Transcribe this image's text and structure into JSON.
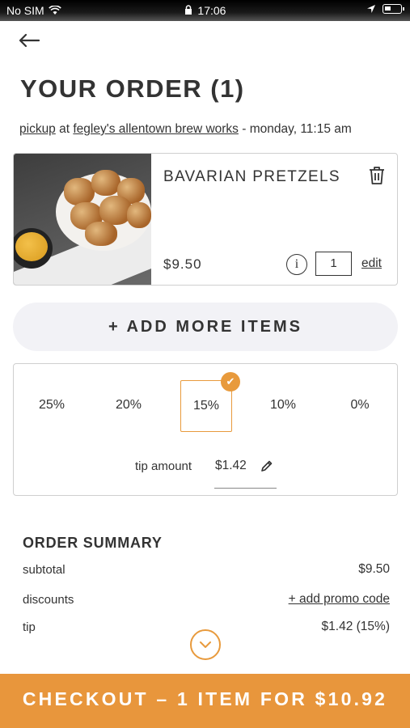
{
  "status_bar": {
    "carrier": "No SIM",
    "time": "17:06"
  },
  "header": {
    "back_icon": "arrow-left-icon",
    "title": "YOUR ORDER (1)"
  },
  "pickup": {
    "mode_link": "pickup",
    "at_text": "at",
    "location_link": "fegley's allentown brew works",
    "time_text": "- monday, 11:15 am"
  },
  "cart_item": {
    "name": "BAVARIAN PRETZELS",
    "price": "$9.50",
    "quantity": "1",
    "info_label": "i",
    "edit_label": "edit",
    "image_alt": "pretzel bites with cheese dip"
  },
  "add_more_label": "+ ADD MORE ITEMS",
  "tip": {
    "options": [
      "25%",
      "20%",
      "15%",
      "10%",
      "0%"
    ],
    "selected": "15%",
    "amount_label": "tip amount",
    "amount_value": "$1.42"
  },
  "summary": {
    "heading": "ORDER SUMMARY",
    "subtotal_label": "subtotal",
    "subtotal_value": "$9.50",
    "discounts_label": "discounts",
    "promo_link": "+ add promo code",
    "tip_label": "tip",
    "tip_value": "$1.42 (15%)"
  },
  "checkout_label": "CHECKOUT – 1 ITEM FOR $10.92",
  "colors": {
    "accent": "#e8963c",
    "text": "#333333",
    "add_more_bg": "#f2f2f6"
  }
}
